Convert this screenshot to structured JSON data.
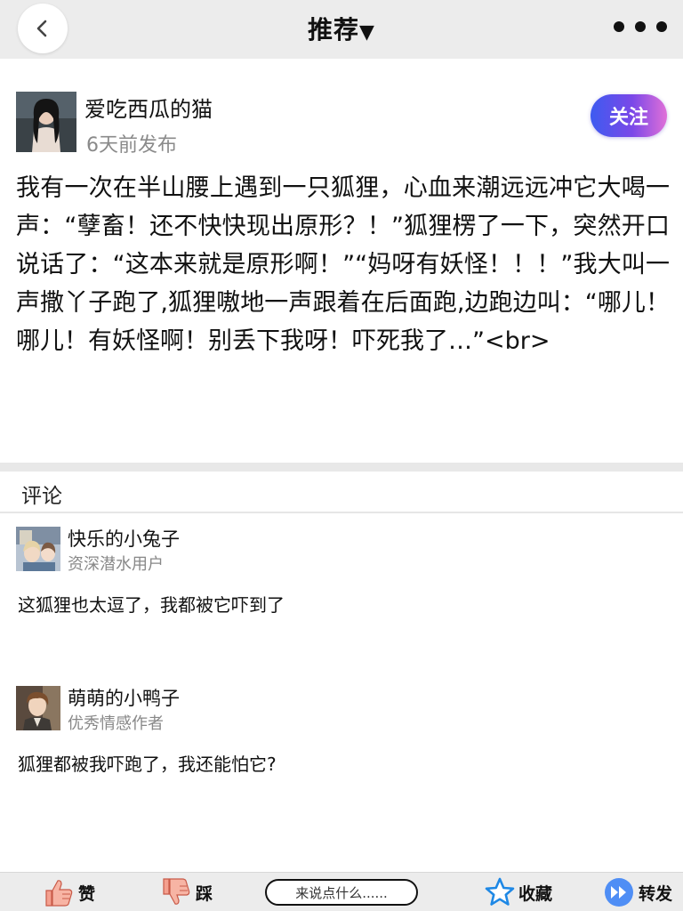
{
  "nav": {
    "title": "推荐",
    "title_arrow": "▼",
    "back_icon": "chevron-left-icon",
    "more_icon": "more-dots-icon"
  },
  "author": {
    "name": "爱吃西瓜的猫",
    "time": "6天前发布",
    "follow_label": "关注"
  },
  "post": {
    "text": "我有一次在半山腰上遇到一只狐狸，心血来潮远远冲它大喝一声：“孽畜！还不快快现出原形？！”狐狸楞了一下，突然开口说话了：“这本来就是原形啊！”“妈呀有妖怪！！！”我大叫一声撒丫子跑了,狐狸嗷地一声跟着在后面跑,边跑边叫：“哪儿！哪儿！有妖怪啊！别丢下我呀！吓死我了…”<br>"
  },
  "comments": {
    "header": "评论",
    "items": [
      {
        "name": "快乐的小兔子",
        "role": "资深潜水用户",
        "text": "这狐狸也太逗了，我都被它吓到了"
      },
      {
        "name": "萌萌的小鸭子",
        "role": "优秀情感作者",
        "text": "狐狸都被我吓跑了，我还能怕它?"
      }
    ]
  },
  "bottom_bar": {
    "like_label": "赞",
    "dislike_label": "踩",
    "comment_placeholder": "来说点什么......",
    "favorite_label": "收藏",
    "share_label": "转发"
  },
  "colors": {
    "accent_gradient_start": "#3d5bf0",
    "accent_gradient_end": "#e070d8",
    "star": "#1e88e5",
    "share": "#3b7cf0",
    "thumb": "#f07c6a"
  }
}
